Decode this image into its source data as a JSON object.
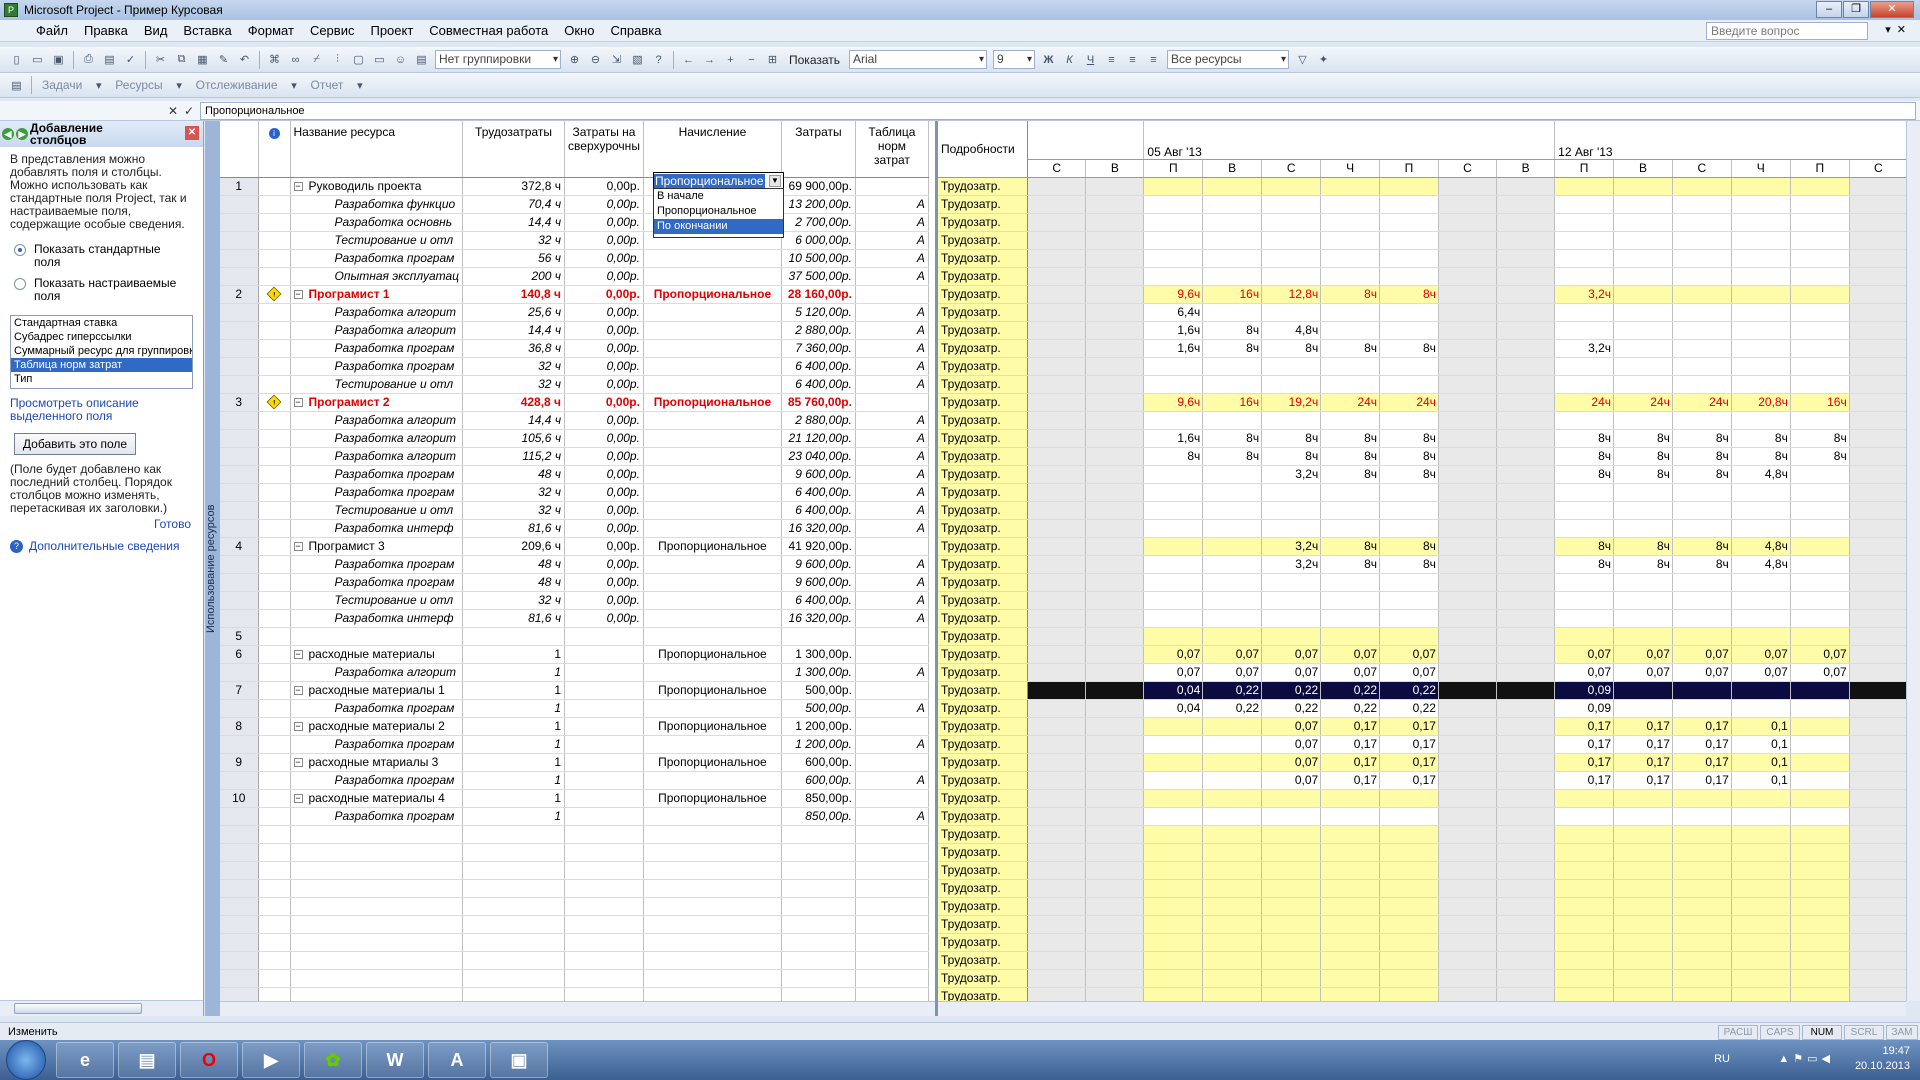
{
  "app": {
    "title": "Microsoft Project - Пример Курсовая"
  },
  "menu": [
    "Файл",
    "Правка",
    "Вид",
    "Вставка",
    "Формат",
    "Сервис",
    "Проект",
    "Совместная работа",
    "Окно",
    "Справка"
  ],
  "help_placeholder": "Введите вопрос",
  "toolbar1": {
    "grouping": "Нет группировки",
    "show": "Показать",
    "font": "Arial",
    "size": "9",
    "bold": "Ж",
    "italic": "К",
    "underline": "Ч",
    "filter": "Все ресурсы"
  },
  "toolbar2": {
    "items": [
      "Задачи",
      "Ресурсы",
      "Отслеживание",
      "Отчет"
    ]
  },
  "entry": {
    "value": "Пропорциональное"
  },
  "side": {
    "title": "Добавление столбцов",
    "intro": "В представления можно добавлять поля и столбцы. Можно использовать как стандартные поля Project, так и настраиваемые поля, содержащие особые сведения.",
    "radio_std": "Показать стандартные поля",
    "radio_custom": "Показать настраиваемые поля",
    "list": [
      "Стандартная ставка",
      "Субадрес гиперссылки",
      "Суммарный ресурс для группировки",
      "Таблица норм затрат",
      "Тип"
    ],
    "selected": "Таблица норм затрат",
    "link": "Просмотреть описание выделенного поля",
    "add_btn": "Добавить это поле",
    "note": "(Поле будет добавлено как последний столбец. Порядок столбцов можно изменять, перетаскивая их заголовки.)",
    "done": "Готово",
    "more": "Дополнительные сведения"
  },
  "view_label": "Использование ресурсов",
  "grid": {
    "headers": {
      "name": "Название ресурса",
      "work": "Трудозатраты",
      "overtime": "Затраты на сверхурочны",
      "accrue": "Начисление",
      "cost": "Затраты",
      "table": "Таблица норм затрат",
      "info": "i"
    },
    "rows": [
      {
        "id": "1",
        "ind": "",
        "name": "Руководиль проекта",
        "work": "372,8 ч",
        "ot": "0,00р.",
        "acc": "Пропорциональное",
        "cost": "69 900,00р.",
        "tab": "",
        "type": "res"
      },
      {
        "id": "",
        "ind": "",
        "name": "Разработка функцио",
        "work": "70,4 ч",
        "ot": "0,00р.",
        "acc": "",
        "cost": "13 200,00р.",
        "tab": "А",
        "type": "sub"
      },
      {
        "id": "",
        "ind": "",
        "name": "Разработка основнь",
        "work": "14,4 ч",
        "ot": "0,00р.",
        "acc": "",
        "cost": "2 700,00р.",
        "tab": "А",
        "type": "sub"
      },
      {
        "id": "",
        "ind": "",
        "name": "Тестирование и отл",
        "work": "32 ч",
        "ot": "0,00р.",
        "acc": "",
        "cost": "6 000,00р.",
        "tab": "А",
        "type": "sub"
      },
      {
        "id": "",
        "ind": "",
        "name": "Разработка програм",
        "work": "56 ч",
        "ot": "0,00р.",
        "acc": "",
        "cost": "10 500,00р.",
        "tab": "А",
        "type": "sub"
      },
      {
        "id": "",
        "ind": "",
        "name": "Опытная эксплуатац",
        "work": "200 ч",
        "ot": "0,00р.",
        "acc": "",
        "cost": "37 500,00р.",
        "tab": "А",
        "type": "sub"
      },
      {
        "id": "2",
        "ind": "!",
        "name": "Програмист 1",
        "work": "140,8 ч",
        "ot": "0,00р.",
        "acc": "Пропорциональное",
        "cost": "28 160,00р.",
        "tab": "",
        "type": "over"
      },
      {
        "id": "",
        "ind": "",
        "name": "Разработка алгорит",
        "work": "25,6 ч",
        "ot": "0,00р.",
        "acc": "",
        "cost": "5 120,00р.",
        "tab": "А",
        "type": "sub"
      },
      {
        "id": "",
        "ind": "",
        "name": "Разработка алгорит",
        "work": "14,4 ч",
        "ot": "0,00р.",
        "acc": "",
        "cost": "2 880,00р.",
        "tab": "А",
        "type": "sub"
      },
      {
        "id": "",
        "ind": "",
        "name": "Разработка програм",
        "work": "36,8 ч",
        "ot": "0,00р.",
        "acc": "",
        "cost": "7 360,00р.",
        "tab": "А",
        "type": "sub"
      },
      {
        "id": "",
        "ind": "",
        "name": "Разработка програм",
        "work": "32 ч",
        "ot": "0,00р.",
        "acc": "",
        "cost": "6 400,00р.",
        "tab": "А",
        "type": "sub"
      },
      {
        "id": "",
        "ind": "",
        "name": "Тестирование и отл",
        "work": "32 ч",
        "ot": "0,00р.",
        "acc": "",
        "cost": "6 400,00р.",
        "tab": "А",
        "type": "sub"
      },
      {
        "id": "3",
        "ind": "!",
        "name": "Програмист 2",
        "work": "428,8 ч",
        "ot": "0,00р.",
        "acc": "Пропорциональное",
        "cost": "85 760,00р.",
        "tab": "",
        "type": "over"
      },
      {
        "id": "",
        "ind": "",
        "name": "Разработка алгорит",
        "work": "14,4 ч",
        "ot": "0,00р.",
        "acc": "",
        "cost": "2 880,00р.",
        "tab": "А",
        "type": "sub"
      },
      {
        "id": "",
        "ind": "",
        "name": "Разработка алгорит",
        "work": "105,6 ч",
        "ot": "0,00р.",
        "acc": "",
        "cost": "21 120,00р.",
        "tab": "А",
        "type": "sub"
      },
      {
        "id": "",
        "ind": "",
        "name": "Разработка алгорит",
        "work": "115,2 ч",
        "ot": "0,00р.",
        "acc": "",
        "cost": "23 040,00р.",
        "tab": "А",
        "type": "sub"
      },
      {
        "id": "",
        "ind": "",
        "name": "Разработка програм",
        "work": "48 ч",
        "ot": "0,00р.",
        "acc": "",
        "cost": "9 600,00р.",
        "tab": "А",
        "type": "sub"
      },
      {
        "id": "",
        "ind": "",
        "name": "Разработка програм",
        "work": "32 ч",
        "ot": "0,00р.",
        "acc": "",
        "cost": "6 400,00р.",
        "tab": "А",
        "type": "sub"
      },
      {
        "id": "",
        "ind": "",
        "name": "Тестирование и отл",
        "work": "32 ч",
        "ot": "0,00р.",
        "acc": "",
        "cost": "6 400,00р.",
        "tab": "А",
        "type": "sub"
      },
      {
        "id": "",
        "ind": "",
        "name": "Разработка интерф",
        "work": "81,6 ч",
        "ot": "0,00р.",
        "acc": "",
        "cost": "16 320,00р.",
        "tab": "А",
        "type": "sub"
      },
      {
        "id": "4",
        "ind": "",
        "name": "Програмист 3",
        "work": "209,6 ч",
        "ot": "0,00р.",
        "acc": "Пропорциональное",
        "cost": "41 920,00р.",
        "tab": "",
        "type": "res"
      },
      {
        "id": "",
        "ind": "",
        "name": "Разработка програм",
        "work": "48 ч",
        "ot": "0,00р.",
        "acc": "",
        "cost": "9 600,00р.",
        "tab": "А",
        "type": "sub"
      },
      {
        "id": "",
        "ind": "",
        "name": "Разработка програм",
        "work": "48 ч",
        "ot": "0,00р.",
        "acc": "",
        "cost": "9 600,00р.",
        "tab": "А",
        "type": "sub"
      },
      {
        "id": "",
        "ind": "",
        "name": "Тестирование и отл",
        "work": "32 ч",
        "ot": "0,00р.",
        "acc": "",
        "cost": "6 400,00р.",
        "tab": "А",
        "type": "sub"
      },
      {
        "id": "",
        "ind": "",
        "name": "Разработка интерф",
        "work": "81,6 ч",
        "ot": "0,00р.",
        "acc": "",
        "cost": "16 320,00р.",
        "tab": "А",
        "type": "sub"
      },
      {
        "id": "5",
        "ind": "",
        "name": "",
        "work": "",
        "ot": "",
        "acc": "",
        "cost": "",
        "tab": "",
        "type": "empty"
      },
      {
        "id": "6",
        "ind": "",
        "name": "расходные материалы",
        "work": "1",
        "ot": "",
        "acc": "Пропорциональное",
        "cost": "1 300,00р.",
        "tab": "",
        "type": "res"
      },
      {
        "id": "",
        "ind": "",
        "name": "Разработка алгорит",
        "work": "1",
        "ot": "",
        "acc": "",
        "cost": "1 300,00р.",
        "tab": "А",
        "type": "sub"
      },
      {
        "id": "7",
        "ind": "",
        "name": "расходные материалы 1",
        "work": "1",
        "ot": "",
        "acc": "Пропорциональное",
        "cost": "500,00р.",
        "tab": "",
        "type": "res"
      },
      {
        "id": "",
        "ind": "",
        "name": "Разработка програм",
        "work": "1",
        "ot": "",
        "acc": "",
        "cost": "500,00р.",
        "tab": "А",
        "type": "sub"
      },
      {
        "id": "8",
        "ind": "",
        "name": "расходные материалы 2",
        "work": "1",
        "ot": "",
        "acc": "Пропорциональное",
        "cost": "1 200,00р.",
        "tab": "",
        "type": "res"
      },
      {
        "id": "",
        "ind": "",
        "name": "Разработка програм",
        "work": "1",
        "ot": "",
        "acc": "",
        "cost": "1 200,00р.",
        "tab": "А",
        "type": "sub"
      },
      {
        "id": "9",
        "ind": "",
        "name": "расходные мтариалы 3",
        "work": "1",
        "ot": "",
        "acc": "Пропорциональное",
        "cost": "600,00р.",
        "tab": "",
        "type": "res"
      },
      {
        "id": "",
        "ind": "",
        "name": "Разработка програм",
        "work": "1",
        "ot": "",
        "acc": "",
        "cost": "600,00р.",
        "tab": "А",
        "type": "sub"
      },
      {
        "id": "10",
        "ind": "",
        "name": "расходные материалы 4",
        "work": "1",
        "ot": "",
        "acc": "Пропорциональное",
        "cost": "850,00р.",
        "tab": "",
        "type": "res"
      },
      {
        "id": "",
        "ind": "",
        "name": "Разработка програм",
        "work": "1",
        "ot": "",
        "acc": "",
        "cost": "850,00р.",
        "tab": "А",
        "type": "sub"
      }
    ],
    "dropdown": {
      "value": "Пропорциональное",
      "options": [
        "В начале",
        "Пропорциональное",
        "По окончании"
      ],
      "selected": "По окончании"
    }
  },
  "timeline": {
    "details_header": "Подробности",
    "week1": "05 Авг '13",
    "week2": "12 Авг '13",
    "days": [
      "С",
      "В",
      "П",
      "В",
      "С",
      "Ч",
      "П",
      "С",
      "В",
      "П",
      "В",
      "С",
      "Ч",
      "П",
      "С"
    ],
    "row_label": "Трудозатр.",
    "rows": [
      [
        "",
        "",
        "",
        "",
        "",
        "",
        "",
        "",
        "",
        "",
        "",
        "",
        "",
        "",
        ""
      ],
      [
        "",
        "",
        "",
        "",
        "",
        "",
        "",
        "",
        "",
        "",
        "",
        "",
        "",
        "",
        ""
      ],
      [
        "",
        "",
        "",
        "",
        "",
        "",
        "",
        "",
        "",
        "",
        "",
        "",
        "",
        "",
        ""
      ],
      [
        "",
        "",
        "",
        "",
        "",
        "",
        "",
        "",
        "",
        "",
        "",
        "",
        "",
        "",
        ""
      ],
      [
        "",
        "",
        "",
        "",
        "",
        "",
        "",
        "",
        "",
        "",
        "",
        "",
        "",
        "",
        ""
      ],
      [
        "",
        "",
        "",
        "",
        "",
        "",
        "",
        "",
        "",
        "",
        "",
        "",
        "",
        "",
        ""
      ],
      [
        "",
        "",
        "9,6ч",
        "16ч",
        "12,8ч",
        "8ч",
        "8ч",
        "",
        "",
        "3,2ч",
        "",
        "",
        "",
        "",
        ""
      ],
      [
        "",
        "",
        "6,4ч",
        "",
        "",
        "",
        "",
        "",
        "",
        "",
        "",
        "",
        "",
        "",
        ""
      ],
      [
        "",
        "",
        "1,6ч",
        "8ч",
        "4,8ч",
        "",
        "",
        "",
        "",
        "",
        "",
        "",
        "",
        "",
        ""
      ],
      [
        "",
        "",
        "1,6ч",
        "8ч",
        "8ч",
        "8ч",
        "8ч",
        "",
        "",
        "3,2ч",
        "",
        "",
        "",
        "",
        ""
      ],
      [
        "",
        "",
        "",
        "",
        "",
        "",
        "",
        "",
        "",
        "",
        "",
        "",
        "",
        "",
        ""
      ],
      [
        "",
        "",
        "",
        "",
        "",
        "",
        "",
        "",
        "",
        "",
        "",
        "",
        "",
        "",
        ""
      ],
      [
        "",
        "",
        "9,6ч",
        "16ч",
        "19,2ч",
        "24ч",
        "24ч",
        "",
        "",
        "24ч",
        "24ч",
        "24ч",
        "20,8ч",
        "16ч",
        ""
      ],
      [
        "",
        "",
        "",
        "",
        "",
        "",
        "",
        "",
        "",
        "",
        "",
        "",
        "",
        "",
        ""
      ],
      [
        "",
        "",
        "1,6ч",
        "8ч",
        "8ч",
        "8ч",
        "8ч",
        "",
        "",
        "8ч",
        "8ч",
        "8ч",
        "8ч",
        "8ч",
        ""
      ],
      [
        "",
        "",
        "8ч",
        "8ч",
        "8ч",
        "8ч",
        "8ч",
        "",
        "",
        "8ч",
        "8ч",
        "8ч",
        "8ч",
        "8ч",
        ""
      ],
      [
        "",
        "",
        "",
        "",
        "3,2ч",
        "8ч",
        "8ч",
        "",
        "",
        "8ч",
        "8ч",
        "8ч",
        "4,8ч",
        "",
        ""
      ],
      [
        "",
        "",
        "",
        "",
        "",
        "",
        "",
        "",
        "",
        "",
        "",
        "",
        "",
        "",
        ""
      ],
      [
        "",
        "",
        "",
        "",
        "",
        "",
        "",
        "",
        "",
        "",
        "",
        "",
        "",
        "",
        ""
      ],
      [
        "",
        "",
        "",
        "",
        "",
        "",
        "",
        "",
        "",
        "",
        "",
        "",
        "",
        "",
        ""
      ],
      [
        "",
        "",
        "",
        "",
        "3,2ч",
        "8ч",
        "8ч",
        "",
        "",
        "8ч",
        "8ч",
        "8ч",
        "4,8ч",
        "",
        ""
      ],
      [
        "",
        "",
        "",
        "",
        "3,2ч",
        "8ч",
        "8ч",
        "",
        "",
        "8ч",
        "8ч",
        "8ч",
        "4,8ч",
        "",
        ""
      ],
      [
        "",
        "",
        "",
        "",
        "",
        "",
        "",
        "",
        "",
        "",
        "",
        "",
        "",
        "",
        ""
      ],
      [
        "",
        "",
        "",
        "",
        "",
        "",
        "",
        "",
        "",
        "",
        "",
        "",
        "",
        "",
        ""
      ],
      [
        "",
        "",
        "",
        "",
        "",
        "",
        "",
        "",
        "",
        "",
        "",
        "",
        "",
        "",
        ""
      ],
      [
        "",
        "",
        "",
        "",
        "",
        "",
        "",
        "",
        "",
        "",
        "",
        "",
        "",
        "",
        ""
      ],
      [
        "",
        "",
        "0,07",
        "0,07",
        "0,07",
        "0,07",
        "0,07",
        "",
        "",
        "0,07",
        "0,07",
        "0,07",
        "0,07",
        "0,07",
        ""
      ],
      [
        "",
        "",
        "0,07",
        "0,07",
        "0,07",
        "0,07",
        "0,07",
        "",
        "",
        "0,07",
        "0,07",
        "0,07",
        "0,07",
        "0,07",
        ""
      ],
      [
        "",
        "",
        "0,04",
        "0,22",
        "0,22",
        "0,22",
        "0,22",
        "",
        "",
        "0,09",
        "",
        "",
        "",
        "",
        ""
      ],
      [
        "",
        "",
        "0,04",
        "0,22",
        "0,22",
        "0,22",
        "0,22",
        "",
        "",
        "0,09",
        "",
        "",
        "",
        "",
        ""
      ],
      [
        "",
        "",
        "",
        "",
        "0,07",
        "0,17",
        "0,17",
        "",
        "",
        "0,17",
        "0,17",
        "0,17",
        "0,1",
        "",
        ""
      ],
      [
        "",
        "",
        "",
        "",
        "0,07",
        "0,17",
        "0,17",
        "",
        "",
        "0,17",
        "0,17",
        "0,17",
        "0,1",
        "",
        ""
      ],
      [
        "",
        "",
        "",
        "",
        "0,07",
        "0,17",
        "0,17",
        "",
        "",
        "0,17",
        "0,17",
        "0,17",
        "0,1",
        "",
        ""
      ],
      [
        "",
        "",
        "",
        "",
        "0,07",
        "0,17",
        "0,17",
        "",
        "",
        "0,17",
        "0,17",
        "0,17",
        "0,1",
        "",
        ""
      ],
      [
        "",
        "",
        "",
        "",
        "",
        "",
        "",
        "",
        "",
        "",
        "",
        "",
        "",
        "",
        ""
      ],
      [
        "",
        "",
        "",
        "",
        "",
        "",
        "",
        "",
        "",
        "",
        "",
        "",
        "",
        "",
        ""
      ]
    ],
    "extra_rows": 12
  },
  "status": {
    "left": "Изменить",
    "indicators": [
      "РАСШ",
      "CAPS",
      "NUM",
      "SCRL",
      "ЗАМ"
    ],
    "active": "NUM"
  },
  "taskbar": {
    "lang": "RU",
    "time": "19:47",
    "date": "20.10.2013",
    "apps": [
      "ie",
      "explorer",
      "opera",
      "media",
      "icq",
      "word",
      "pdf",
      "project"
    ]
  }
}
